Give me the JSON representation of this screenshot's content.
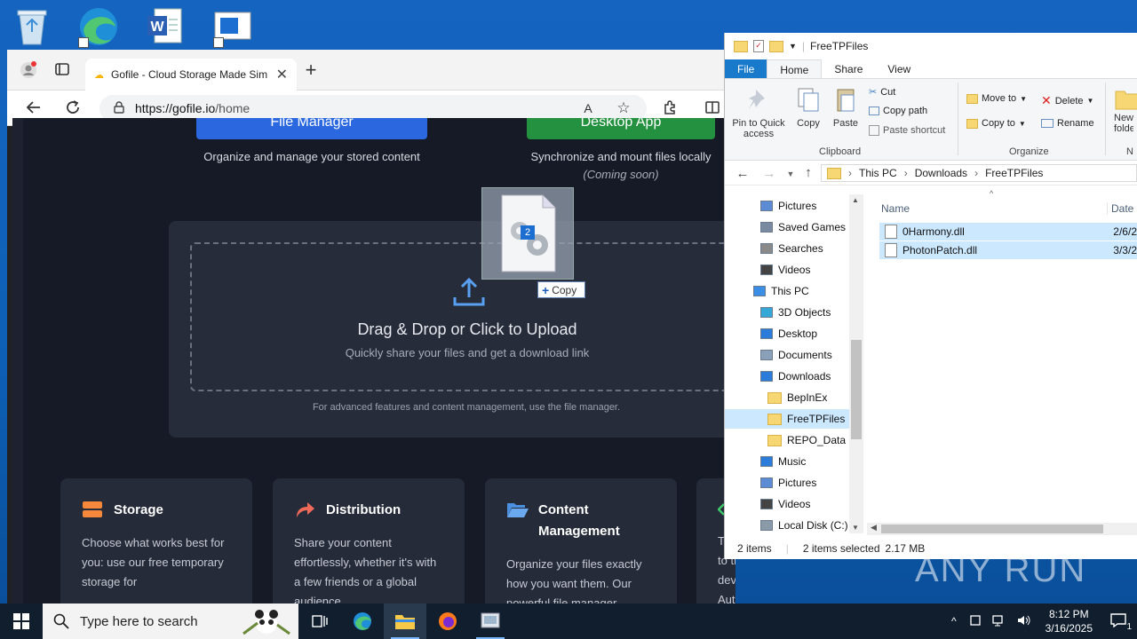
{
  "browser": {
    "tab_title": "Gofile - Cloud Storage Made Sim",
    "url_host": "https://gofile.io",
    "url_path": "/home"
  },
  "gofile": {
    "file_manager_label": "File Manager",
    "desktop_app_label": "Desktop App",
    "file_manager_caption": "Organize and manage your stored content",
    "desktop_app_caption": "Synchronize and mount files locally",
    "desktop_app_note": "(Coming soon)",
    "drop_title": "Drag & Drop or Click to Upload",
    "drop_subtitle": "Quickly share your files and get a download link",
    "advanced_note": "For advanced features and content management, use the file manager.",
    "features": [
      {
        "title": "Storage",
        "text": "Choose what works best for you: use our free temporary storage for",
        "color": "#f5883b"
      },
      {
        "title": "Distribution",
        "text": "Share your content effortlessly, whether it's with a few friends or a global audience.",
        "color": "#f06a5a"
      },
      {
        "title": "Content Management",
        "text": "Organize your files exactly how you want them. Our powerful file manager",
        "color": "#4a8fe0"
      },
      {
        "title": "",
        "text": "Take your file management to the next level with our developer-friendly API. Automate uploads.",
        "color": "#3ec86a"
      }
    ]
  },
  "drag": {
    "badge_count": "2",
    "copy_label": "Copy"
  },
  "explorer": {
    "title": "FreeTPFiles",
    "tabs": [
      "File",
      "Home",
      "Share",
      "View"
    ],
    "ribbon": {
      "pin_label": "Pin to Quick access",
      "copy_label": "Copy",
      "paste_label": "Paste",
      "cut_label": "Cut",
      "copy_path_label": "Copy path",
      "paste_shortcut_label": "Paste shortcut",
      "clipboard_group": "Clipboard",
      "move_to_label": "Move to",
      "copy_to_label": "Copy to",
      "delete_label": "Delete",
      "rename_label": "Rename",
      "organize_group": "Organize",
      "new_folder_label": "New folder",
      "new_group_initial": "N"
    },
    "breadcrumb": [
      "This PC",
      "Downloads",
      "FreeTPFiles"
    ],
    "tree": [
      {
        "label": "Pictures",
        "indent": 2,
        "icon": "pictures-icon"
      },
      {
        "label": "Saved Games",
        "indent": 2,
        "icon": "saved-games-icon"
      },
      {
        "label": "Searches",
        "indent": 2,
        "icon": "searches-icon"
      },
      {
        "label": "Videos",
        "indent": 2,
        "icon": "videos-icon"
      },
      {
        "label": "This PC",
        "indent": 1,
        "icon": "this-pc-icon"
      },
      {
        "label": "3D Objects",
        "indent": 2,
        "icon": "3d-objects-icon"
      },
      {
        "label": "Desktop",
        "indent": 2,
        "icon": "desktop-icon"
      },
      {
        "label": "Documents",
        "indent": 2,
        "icon": "documents-icon"
      },
      {
        "label": "Downloads",
        "indent": 2,
        "icon": "downloads-icon"
      },
      {
        "label": "BepInEx",
        "indent": 3,
        "icon": "folder-icon"
      },
      {
        "label": "FreeTPFiles",
        "indent": 3,
        "icon": "folder-icon",
        "selected": true
      },
      {
        "label": "REPO_Data",
        "indent": 3,
        "icon": "folder-icon"
      },
      {
        "label": "Music",
        "indent": 2,
        "icon": "music-icon"
      },
      {
        "label": "Pictures",
        "indent": 2,
        "icon": "pictures-icon"
      },
      {
        "label": "Videos",
        "indent": 2,
        "icon": "videos-icon"
      },
      {
        "label": "Local Disk (C:)",
        "indent": 2,
        "icon": "local-disk-icon"
      }
    ],
    "columns": {
      "name": "Name",
      "date": "Date"
    },
    "files": [
      {
        "name": "0Harmony.dll",
        "date": "2/6/2"
      },
      {
        "name": "PhotonPatch.dll",
        "date": "3/3/2"
      }
    ],
    "status": {
      "items": "2 items",
      "selected": "2 items selected",
      "size": "2.17 MB"
    }
  },
  "watermark": "ANY RUN",
  "taskbar": {
    "search_placeholder": "Type here to search",
    "time": "8:12 PM",
    "date": "3/16/2025",
    "notification_count": "1"
  }
}
